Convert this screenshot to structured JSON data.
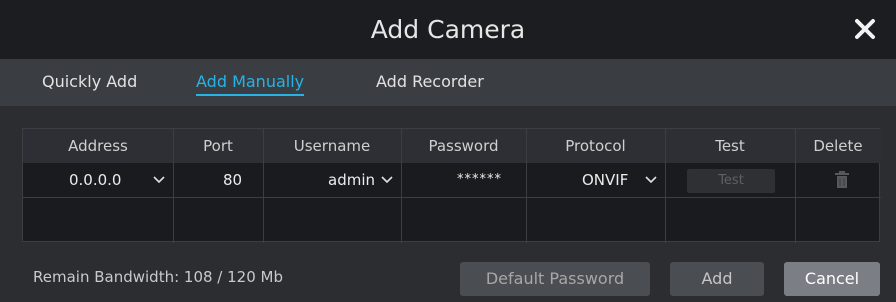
{
  "window": {
    "title": "Add Camera"
  },
  "tabs": [
    {
      "label": "Quickly Add",
      "active": false
    },
    {
      "label": "Add Manually",
      "active": true
    },
    {
      "label": "Add Recorder",
      "active": false
    }
  ],
  "table": {
    "headers": [
      "Address",
      "Port",
      "Username",
      "Password",
      "Protocol",
      "Test",
      "Delete"
    ],
    "rows": [
      {
        "address": "0.0.0.0",
        "port": "80",
        "username": "admin",
        "password": "******",
        "protocol": "ONVIF",
        "test_label": "Test"
      }
    ]
  },
  "footer": {
    "bandwidth_text": "Remain Bandwidth: 108 / 120 Mb",
    "default_password_label": "Default Password",
    "add_label": "Add",
    "cancel_label": "Cancel"
  },
  "icons": {
    "close": "close-icon",
    "dropdown": "chevron-down-icon",
    "delete": "trash-icon"
  },
  "colors": {
    "accent": "#27b3e6"
  }
}
